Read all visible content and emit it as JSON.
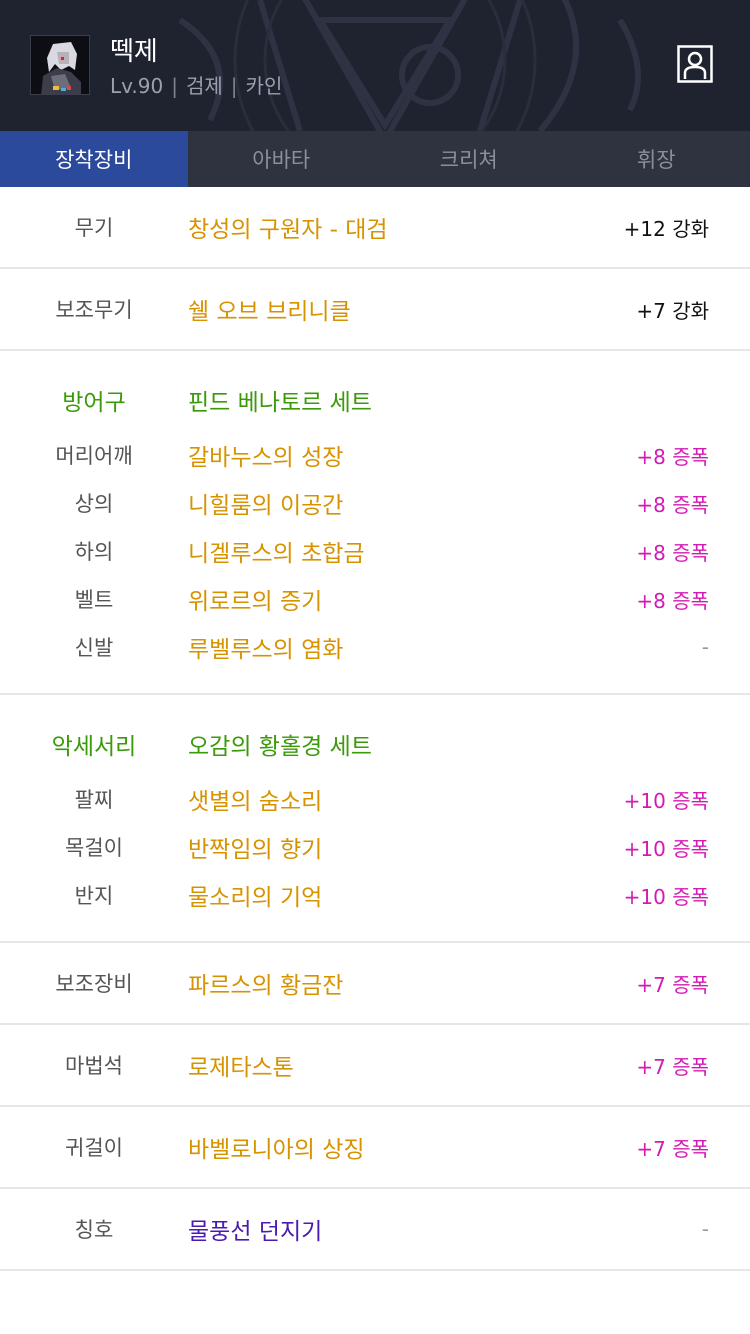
{
  "character": {
    "name": "떽제",
    "level": "Lv.90",
    "class": "검제",
    "server": "카인",
    "separator": "|"
  },
  "tabs": [
    {
      "label": "장착장비",
      "active": true
    },
    {
      "label": "아바타",
      "active": false
    },
    {
      "label": "크리쳐",
      "active": false
    },
    {
      "label": "휘장",
      "active": false
    }
  ],
  "weapon": {
    "slot": "무기",
    "name": "창성의 구원자 - 대검",
    "value": "+12 강화"
  },
  "subweapon": {
    "slot": "보조무기",
    "name": "쉘 오브 브리니클",
    "value": "+7 강화"
  },
  "armor": {
    "category": "방어구",
    "set_name": "핀드 베나토르 세트",
    "items": [
      {
        "slot": "머리어깨",
        "name": "갈바누스의 성장",
        "value": "+8 증폭"
      },
      {
        "slot": "상의",
        "name": "니힐룸의 이공간",
        "value": "+8 증폭"
      },
      {
        "slot": "하의",
        "name": "니겔루스의 초합금",
        "value": "+8 증폭"
      },
      {
        "slot": "벨트",
        "name": "위로르의 증기",
        "value": "+8 증폭"
      },
      {
        "slot": "신발",
        "name": "루벨루스의 염화",
        "value": "-"
      }
    ]
  },
  "accessory": {
    "category": "악세서리",
    "set_name": "오감의 황홀경 세트",
    "items": [
      {
        "slot": "팔찌",
        "name": "샛별의 숨소리",
        "value": "+10 증폭"
      },
      {
        "slot": "목걸이",
        "name": "반짝임의 향기",
        "value": "+10 증폭"
      },
      {
        "slot": "반지",
        "name": "물소리의 기억",
        "value": "+10 증폭"
      }
    ]
  },
  "support": {
    "slot": "보조장비",
    "name": "파르스의 황금잔",
    "value": "+7 증폭"
  },
  "magicstone": {
    "slot": "마법석",
    "name": "로제타스톤",
    "value": "+7 증폭"
  },
  "earring": {
    "slot": "귀걸이",
    "name": "바벨로니아의 상징",
    "value": "+7 증폭"
  },
  "title": {
    "slot": "칭호",
    "name": "물풍선 던지기",
    "value": "-"
  },
  "colors": {
    "item_name": "#d79200",
    "set_name": "#3a9a0a",
    "amplify": "#d41ab4",
    "title_name": "#4a1bb0",
    "active_tab": "#2c4a9c"
  },
  "icons": {
    "avatar": "character-portrait",
    "profile": "person-icon"
  }
}
